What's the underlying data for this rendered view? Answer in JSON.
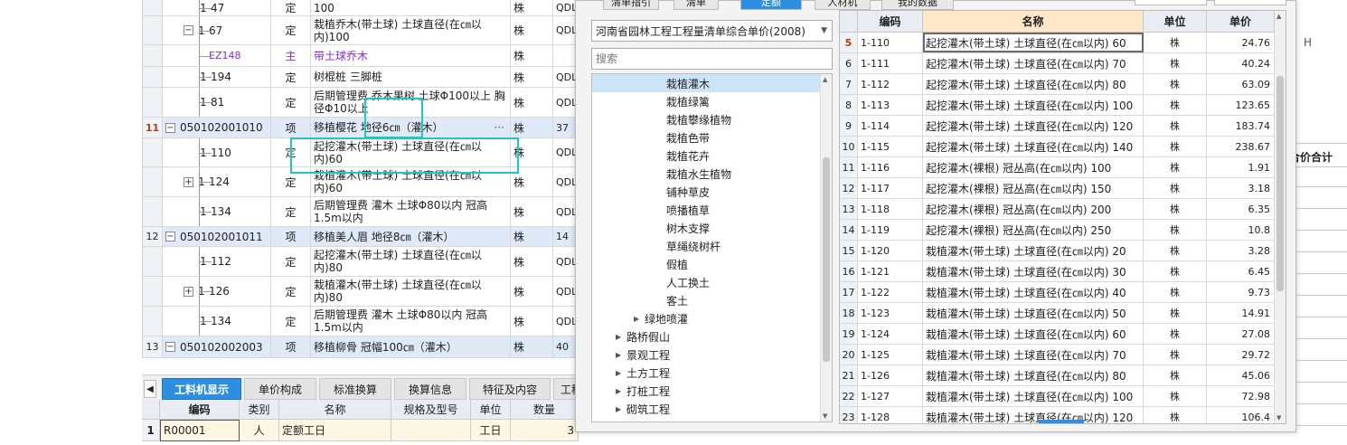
{
  "main_grid": {
    "rows": [
      {
        "num": "",
        "code": "1-47",
        "type": "定",
        "name": "100",
        "unit": "株",
        "qty": "QDL",
        "kind": "child",
        "h": 18
      },
      {
        "num": "",
        "code": "1-67",
        "type": "定",
        "name": "栽植乔木(带土球) 土球直径(在㎝以内)100",
        "unit": "株",
        "qty": "QDL",
        "kind": "exp",
        "h": 32
      },
      {
        "num": "",
        "code": "EZ148",
        "type": "主",
        "name": "带土球乔木",
        "unit": "株",
        "qty": "",
        "kind": "child-purple",
        "h": 24
      },
      {
        "num": "",
        "code": "1-194",
        "type": "定",
        "name": "树棍桩 三脚桩",
        "unit": "株",
        "qty": "QDL",
        "kind": "child",
        "h": 23
      },
      {
        "num": "",
        "code": "1-81",
        "type": "定",
        "name": "后期管理费 乔木果树 土球Φ100以上 胸径Φ10以上",
        "unit": "株",
        "qty": "QDL",
        "kind": "child",
        "h": 33
      },
      {
        "num": "11",
        "code": "050102001010",
        "type": "项",
        "name": "移植樱花   地径6㎝（灌木）",
        "unit": "株",
        "qty": "37",
        "kind": "item",
        "h": 23
      },
      {
        "num": "",
        "code": "1-110",
        "type": "定",
        "name": "起挖灌木(带土球) 土球直径(在㎝以内)60",
        "unit": "株",
        "qty": "QDL",
        "kind": "child",
        "h": 32
      },
      {
        "num": "",
        "code": "1-124",
        "type": "定",
        "name": "栽植灌木(带土球) 土球直径(在㎝以内)60",
        "unit": "株",
        "qty": "QDL",
        "kind": "exp",
        "h": 33
      },
      {
        "num": "",
        "code": "1-134",
        "type": "定",
        "name": "后期管理费 灌木 土球Φ80以内 冠高1.5m以内",
        "unit": "株",
        "qty": "QDL",
        "kind": "child",
        "h": 33
      },
      {
        "num": "12",
        "code": "050102001011",
        "type": "项",
        "name": "移植美人眉   地径8㎝（灌木）",
        "unit": "株",
        "qty": "14",
        "kind": "item",
        "h": 22
      },
      {
        "num": "",
        "code": "1-112",
        "type": "定",
        "name": "起挖灌木(带土球) 土球直径(在㎝以内)80",
        "unit": "株",
        "qty": "QDL",
        "kind": "child",
        "h": 33
      },
      {
        "num": "",
        "code": "1-126",
        "type": "定",
        "name": "栽植灌木(带土球) 土球直径(在㎝以内)80",
        "unit": "株",
        "qty": "QDL",
        "kind": "exp",
        "h": 33
      },
      {
        "num": "",
        "code": "1-134",
        "type": "定",
        "name": "后期管理费 灌木 土球Φ80以内 冠高1.5m以内",
        "unit": "株",
        "qty": "QDL",
        "kind": "child",
        "h": 33
      },
      {
        "num": "13",
        "code": "050102002003",
        "type": "项",
        "name": "移植柳骨   冠幅100㎝（灌木）",
        "unit": "株",
        "qty": "40",
        "kind": "item",
        "h": 24
      }
    ],
    "ellipsis": "···"
  },
  "bottom_tabs": [
    {
      "label": "工料机显示",
      "active": true
    },
    {
      "label": "单价构成",
      "active": false
    },
    {
      "label": "标准换算",
      "active": false
    },
    {
      "label": "换算信息",
      "active": false
    },
    {
      "label": "特征及内容",
      "active": false
    },
    {
      "label": "工程",
      "active": false
    }
  ],
  "sub_grid": {
    "headers": [
      "编码",
      "类别",
      "名称",
      "规格及型号",
      "单位",
      "数量"
    ],
    "row": {
      "num": "1",
      "code": "R00001",
      "type": "人",
      "name": "定额工日",
      "spec": "",
      "unit": "工日",
      "qty": "3"
    }
  },
  "background_sheet": {
    "col_letter": "H",
    "header_text": "合价合计"
  },
  "dialog": {
    "tabs": [
      {
        "label": "清单指引",
        "active": false
      },
      {
        "label": "清单",
        "active": false
      },
      {
        "label": "定额",
        "active": true
      },
      {
        "label": "人材机",
        "active": false
      },
      {
        "label": "我的数据",
        "active": false
      }
    ],
    "library": "河南省园林工程工程量清单综合单价(2008)",
    "search_placeholder": "搜索",
    "tree": [
      {
        "label": "栽植灌木",
        "level": 2,
        "selected": true
      },
      {
        "label": "栽植绿篱",
        "level": 2
      },
      {
        "label": "栽植攀缘植物",
        "level": 2
      },
      {
        "label": "栽植色带",
        "level": 2
      },
      {
        "label": "栽植花卉",
        "level": 2
      },
      {
        "label": "栽植水生植物",
        "level": 2
      },
      {
        "label": "铺种草皮",
        "level": 2
      },
      {
        "label": "喷播植草",
        "level": 2
      },
      {
        "label": "树木支撑",
        "level": 2
      },
      {
        "label": "草绳绕树杆",
        "level": 2
      },
      {
        "label": "假植",
        "level": 2
      },
      {
        "label": "人工换土",
        "level": 2
      },
      {
        "label": "客土",
        "level": 2
      },
      {
        "label": "绿地喷灌",
        "level": 1,
        "arrow": true
      },
      {
        "label": "路桥假山",
        "level": 0,
        "arrow": true
      },
      {
        "label": "景观工程",
        "level": 0,
        "arrow": true
      },
      {
        "label": "土方工程",
        "level": 0,
        "arrow": true
      },
      {
        "label": "打桩工程",
        "level": 0,
        "arrow": true
      },
      {
        "label": "砌筑工程",
        "level": 0,
        "arrow": true
      }
    ],
    "result_headers": {
      "idx": "",
      "code": "编码",
      "name": "名称",
      "unit": "单位",
      "price": "单价"
    },
    "results": [
      {
        "idx": "5",
        "code": "1-110",
        "name": "起挖灌木(带土球) 土球直径(在㎝以内) 60",
        "unit": "株",
        "price": "24.76",
        "selected": true
      },
      {
        "idx": "6",
        "code": "1-111",
        "name": "起挖灌木(带土球) 土球直径(在㎝以内) 70",
        "unit": "株",
        "price": "40.24"
      },
      {
        "idx": "7",
        "code": "1-112",
        "name": "起挖灌木(带土球) 土球直径(在㎝以内) 80",
        "unit": "株",
        "price": "63.09"
      },
      {
        "idx": "8",
        "code": "1-113",
        "name": "起挖灌木(带土球) 土球直径(在㎝以内) 100",
        "unit": "株",
        "price": "123.65"
      },
      {
        "idx": "9",
        "code": "1-114",
        "name": "起挖灌木(带土球) 土球直径(在㎝以内) 120",
        "unit": "株",
        "price": "183.74"
      },
      {
        "idx": "10",
        "code": "1-115",
        "name": "起挖灌木(带土球) 土球直径(在㎝以内) 140",
        "unit": "株",
        "price": "238.67"
      },
      {
        "idx": "11",
        "code": "1-116",
        "name": "起挖灌木(裸根) 冠丛高(在㎝以内) 100",
        "unit": "株",
        "price": "1.91"
      },
      {
        "idx": "12",
        "code": "1-117",
        "name": "起挖灌木(裸根) 冠丛高(在㎝以内) 150",
        "unit": "株",
        "price": "3.18"
      },
      {
        "idx": "13",
        "code": "1-118",
        "name": "起挖灌木(裸根) 冠丛高(在㎝以内) 200",
        "unit": "株",
        "price": "6.35"
      },
      {
        "idx": "14",
        "code": "1-119",
        "name": "起挖灌木(裸根) 冠丛高(在㎝以内) 250",
        "unit": "株",
        "price": "10.8"
      },
      {
        "idx": "15",
        "code": "1-120",
        "name": "栽植灌木(带土球) 土球直径(在㎝以内) 20",
        "unit": "株",
        "price": "3.28"
      },
      {
        "idx": "16",
        "code": "1-121",
        "name": "栽植灌木(带土球) 土球直径(在㎝以内) 30",
        "unit": "株",
        "price": "6.45"
      },
      {
        "idx": "17",
        "code": "1-122",
        "name": "栽植灌木(带土球) 土球直径(在㎝以内) 40",
        "unit": "株",
        "price": "9.73"
      },
      {
        "idx": "18",
        "code": "1-123",
        "name": "栽植灌木(带土球) 土球直径(在㎝以内) 50",
        "unit": "株",
        "price": "14.91"
      },
      {
        "idx": "19",
        "code": "1-124",
        "name": "栽植灌木(带土球) 土球直径(在㎝以内) 60",
        "unit": "株",
        "price": "27.08"
      },
      {
        "idx": "20",
        "code": "1-125",
        "name": "栽植灌木(带土球) 土球直径(在㎝以内) 70",
        "unit": "株",
        "price": "29.72"
      },
      {
        "idx": "21",
        "code": "1-126",
        "name": "栽植灌木(带土球) 土球直径(在㎝以内) 80",
        "unit": "株",
        "price": "45.06"
      },
      {
        "idx": "22",
        "code": "1-127",
        "name": "栽植灌木(带土球) 土球直径(在㎝以内) 100",
        "unit": "株",
        "price": "72.98"
      },
      {
        "idx": "23",
        "code": "1-128",
        "name": "栽植灌木(带土球) 土球直径(在㎝以内) 120",
        "unit": "株",
        "price": "106.4"
      }
    ]
  },
  "colors": {
    "accent": "#2e8fe0",
    "selection": "#1ec6c6",
    "item_row": "#dfe9f7",
    "header_highlight": "#fde7c6"
  }
}
